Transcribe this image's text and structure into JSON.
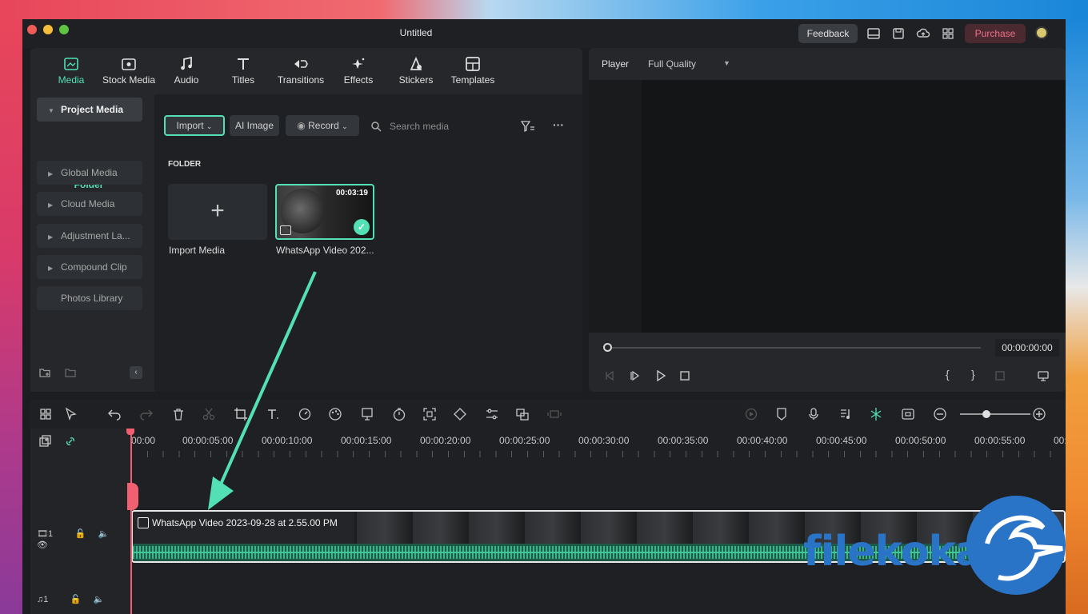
{
  "window": {
    "title": "Untitled"
  },
  "titlebar": {
    "feedback_label": "Feedback",
    "purchase_label": "Purchase"
  },
  "tabs": [
    {
      "label": "Media",
      "icon": "media-icon"
    },
    {
      "label": "Stock Media",
      "icon": "stock-media-icon"
    },
    {
      "label": "Audio",
      "icon": "music-note-icon"
    },
    {
      "label": "Titles",
      "icon": "titles-icon"
    },
    {
      "label": "Transitions",
      "icon": "transitions-icon"
    },
    {
      "label": "Effects",
      "icon": "effects-icon"
    },
    {
      "label": "Stickers",
      "icon": "stickers-icon"
    },
    {
      "label": "Templates",
      "icon": "templates-icon"
    }
  ],
  "sidebar": {
    "project_media": "Project Media",
    "folder": "Folder",
    "items": [
      "Global Media",
      "Cloud Media",
      "Adjustment La...",
      "Compound Clip",
      "Photos Library"
    ]
  },
  "media_toolbar": {
    "import_label": "Import",
    "ai_image_label": "AI Image",
    "record_label": "Record",
    "search_placeholder": "Search media"
  },
  "media": {
    "section_label": "FOLDER",
    "import_tile_label": "Import Media",
    "video_label": "WhatsApp Video 202...",
    "video_duration": "00:03:19"
  },
  "player": {
    "label": "Player",
    "quality": "Full Quality",
    "timecode": "00:00:00:00",
    "progress": 0
  },
  "timeline": {
    "ruler": [
      "00:00",
      "00:00:05:00",
      "00:00:10:00",
      "00:00:15:00",
      "00:00:20:00",
      "00:00:25:00",
      "00:00:30:00",
      "00:00:35:00",
      "00:00:40:00",
      "00:00:45:00",
      "00:00:50:00",
      "00:00:55:00",
      "00:0"
    ],
    "clip_title": "WhatsApp Video 2023-09-28 at 2.55.00 PM",
    "video_track_num": "1",
    "audio_track_num": "1"
  },
  "watermark": {
    "text": "filekoka"
  },
  "colors": {
    "accent": "#52e0b4",
    "playhead": "#f06070",
    "purchase": "#f0708a"
  }
}
